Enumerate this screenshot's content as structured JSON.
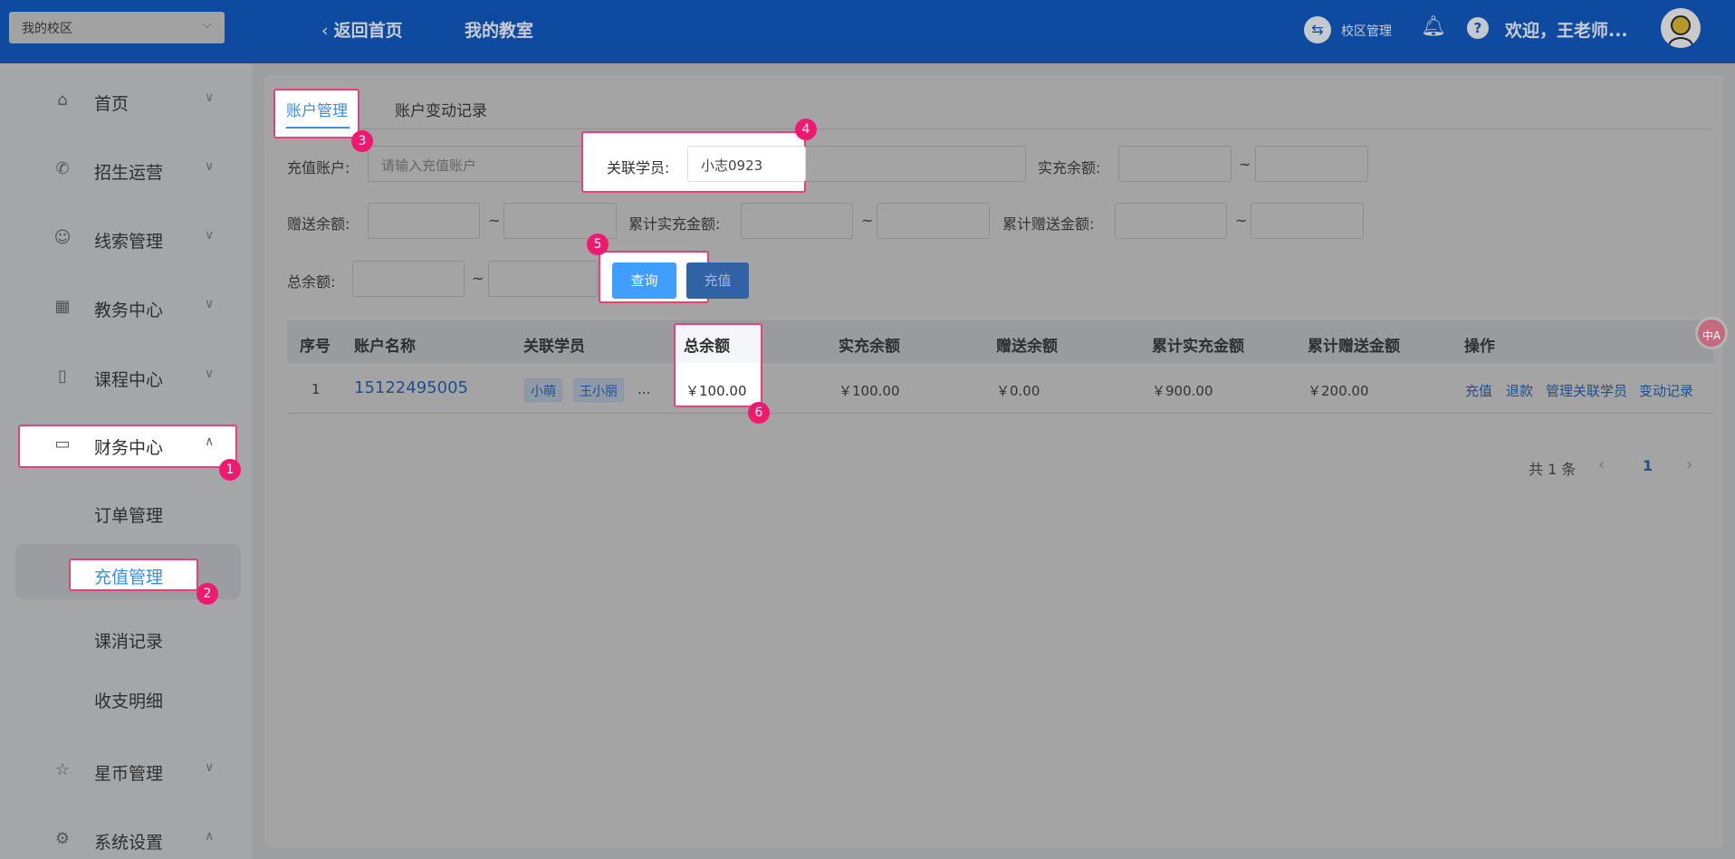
{
  "header": {
    "campus_select": "我的校区",
    "back": "返回首页",
    "classroom": "我的教室",
    "campus_manage": "校区管理",
    "welcome": "欢迎，王老师..."
  },
  "sidebar": {
    "items": [
      {
        "label": "首页"
      },
      {
        "label": "招生运营"
      },
      {
        "label": "线索管理"
      },
      {
        "label": "教务中心"
      },
      {
        "label": "课程中心"
      },
      {
        "label": "财务中心"
      },
      {
        "label": "星币管理"
      },
      {
        "label": "系统设置"
      }
    ],
    "finance_sub": [
      "订单管理",
      "充值管理",
      "课消记录",
      "收支明细"
    ]
  },
  "tabs": [
    "账户管理",
    "账户变动记录"
  ],
  "filters": {
    "account_label": "充值账户:",
    "account_placeholder": "请输入充值账户",
    "student_label": "关联学员:",
    "student_value": "小志0923",
    "real_balance_label": "实充余额:",
    "gift_balance_label": "赠送余额:",
    "total_real_label": "累计实充金额:",
    "total_gift_label": "累计赠送金额:",
    "total_balance_label": "总余额:",
    "tilde": "~",
    "query": "查询",
    "recharge": "充值"
  },
  "table": {
    "headers": [
      "序号",
      "账户名称",
      "关联学员",
      "总余额",
      "实充余额",
      "赠送余额",
      "累计实充金额",
      "累计赠送金额",
      "操作"
    ],
    "rows": [
      {
        "index": "1",
        "account": "15122495005",
        "students": [
          "小萌",
          "王小丽"
        ],
        "more": "...",
        "total": "￥100.00",
        "real": "￥100.00",
        "gift": "￥0.00",
        "total_real": "￥900.00",
        "total_gift": "￥200.00",
        "actions": [
          "充值",
          "退款",
          "管理关联学员",
          "变动记录"
        ]
      }
    ]
  },
  "pagination": {
    "total": "共 1 条",
    "current": "1"
  },
  "badges": [
    "1",
    "2",
    "3",
    "4",
    "5",
    "6"
  ],
  "translate": "中A",
  "colors": {
    "header": "#0e4ba0",
    "highlight_border": "#e9407a",
    "badge": "#f0196f",
    "primary": "#409eff"
  }
}
